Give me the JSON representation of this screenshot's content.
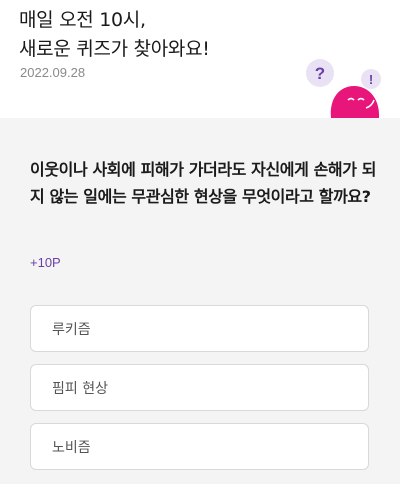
{
  "header": {
    "headline_line1": "매일 오전 10시,",
    "headline_line2": "새로운 퀴즈가 찾아와요!",
    "date": "2022.09.28"
  },
  "mascot": {
    "icon": "pink-blob-character-with-question-marks",
    "question_mark": "?",
    "exclamation_mark": "!",
    "colors": {
      "body": "#e8157a",
      "bubble": "#e9e2f5",
      "mark": "#6a3fa6"
    }
  },
  "quiz": {
    "question": "이웃이나 사회에 피해가 가더라도 자신에게 손해가 되지 않는 일에는 무관심한 현상을 무엇이라고 할까요?",
    "points": "+10P",
    "options": [
      "루키즘",
      "핌피 현상",
      "노비즘"
    ]
  },
  "colors": {
    "accent": "#6a3fa6",
    "quiz_background": "#f4f4f4"
  }
}
